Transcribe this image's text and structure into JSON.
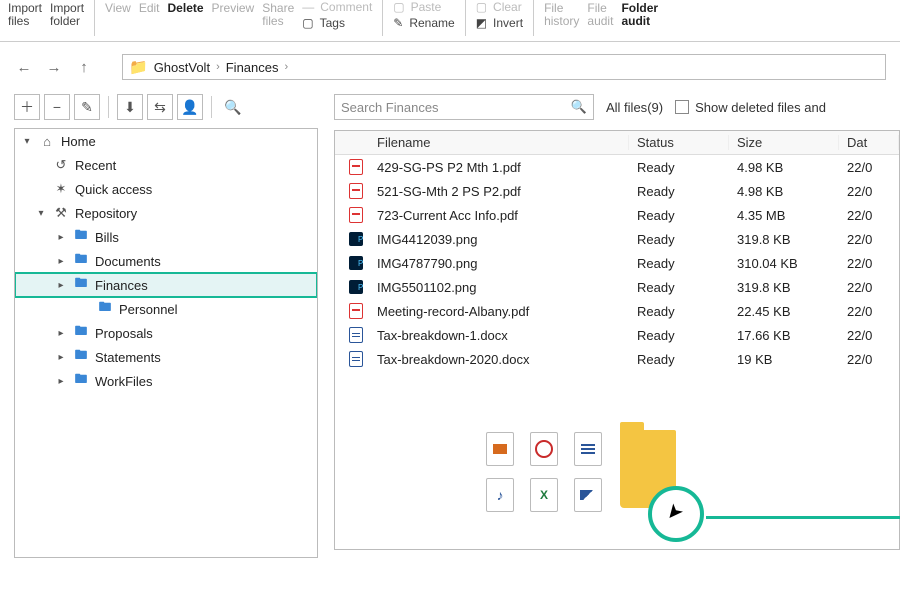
{
  "ribbon": {
    "import_files": "Import\nfiles",
    "import_folder": "Import\nfolder",
    "view": "View",
    "edit": "Edit",
    "delete": "Delete",
    "preview": "Preview",
    "share_files": "Share\nfiles",
    "comment": "Comment",
    "tags": "Tags",
    "paste": "Paste",
    "rename": "Rename",
    "clear": "Clear",
    "invert": "Invert",
    "file_history": "File\nhistory",
    "file_audit": "File\naudit",
    "folder_audit": "Folder\naudit"
  },
  "breadcrumb": {
    "root": "GhostVolt",
    "current": "Finances"
  },
  "tree": {
    "home": "Home",
    "recent": "Recent",
    "quick": "Quick access",
    "repo": "Repository",
    "items": [
      "Bills",
      "Documents",
      "Finances",
      "Personnel",
      "Proposals",
      "Statements",
      "WorkFiles"
    ],
    "selected": "Finances"
  },
  "search": {
    "placeholder": "Search Finances"
  },
  "filter": {
    "label": "All files",
    "count": 9
  },
  "showDeleted": "Show deleted files and",
  "columns": {
    "name": "Filename",
    "status": "Status",
    "size": "Size",
    "date": "Dat"
  },
  "files": [
    {
      "icon": "pdf",
      "name": "429-SG-PS P2 Mth 1.pdf",
      "status": "Ready",
      "size": "4.98 KB",
      "date": "22/0"
    },
    {
      "icon": "pdf",
      "name": "521-SG-Mth 2 PS P2.pdf",
      "status": "Ready",
      "size": "4.98 KB",
      "date": "22/0"
    },
    {
      "icon": "pdf",
      "name": "723-Current Acc Info.pdf",
      "status": "Ready",
      "size": "4.35 MB",
      "date": "22/0"
    },
    {
      "icon": "ps",
      "name": "IMG4412039.png",
      "status": "Ready",
      "size": "319.8 KB",
      "date": "22/0"
    },
    {
      "icon": "ps",
      "name": "IMG4787790.png",
      "status": "Ready",
      "size": "310.04 KB",
      "date": "22/0"
    },
    {
      "icon": "ps",
      "name": "IMG5501102.png",
      "status": "Ready",
      "size": "319.8 KB",
      "date": "22/0"
    },
    {
      "icon": "pdf",
      "name": "Meeting-record-Albany.pdf",
      "status": "Ready",
      "size": "22.45 KB",
      "date": "22/0"
    },
    {
      "icon": "doc",
      "name": "Tax-breakdown-1.docx",
      "status": "Ready",
      "size": "17.66 KB",
      "date": "22/0"
    },
    {
      "icon": "doc",
      "name": "Tax-breakdown-2020.docx",
      "status": "Ready",
      "size": "19 KB",
      "date": "22/0"
    }
  ]
}
